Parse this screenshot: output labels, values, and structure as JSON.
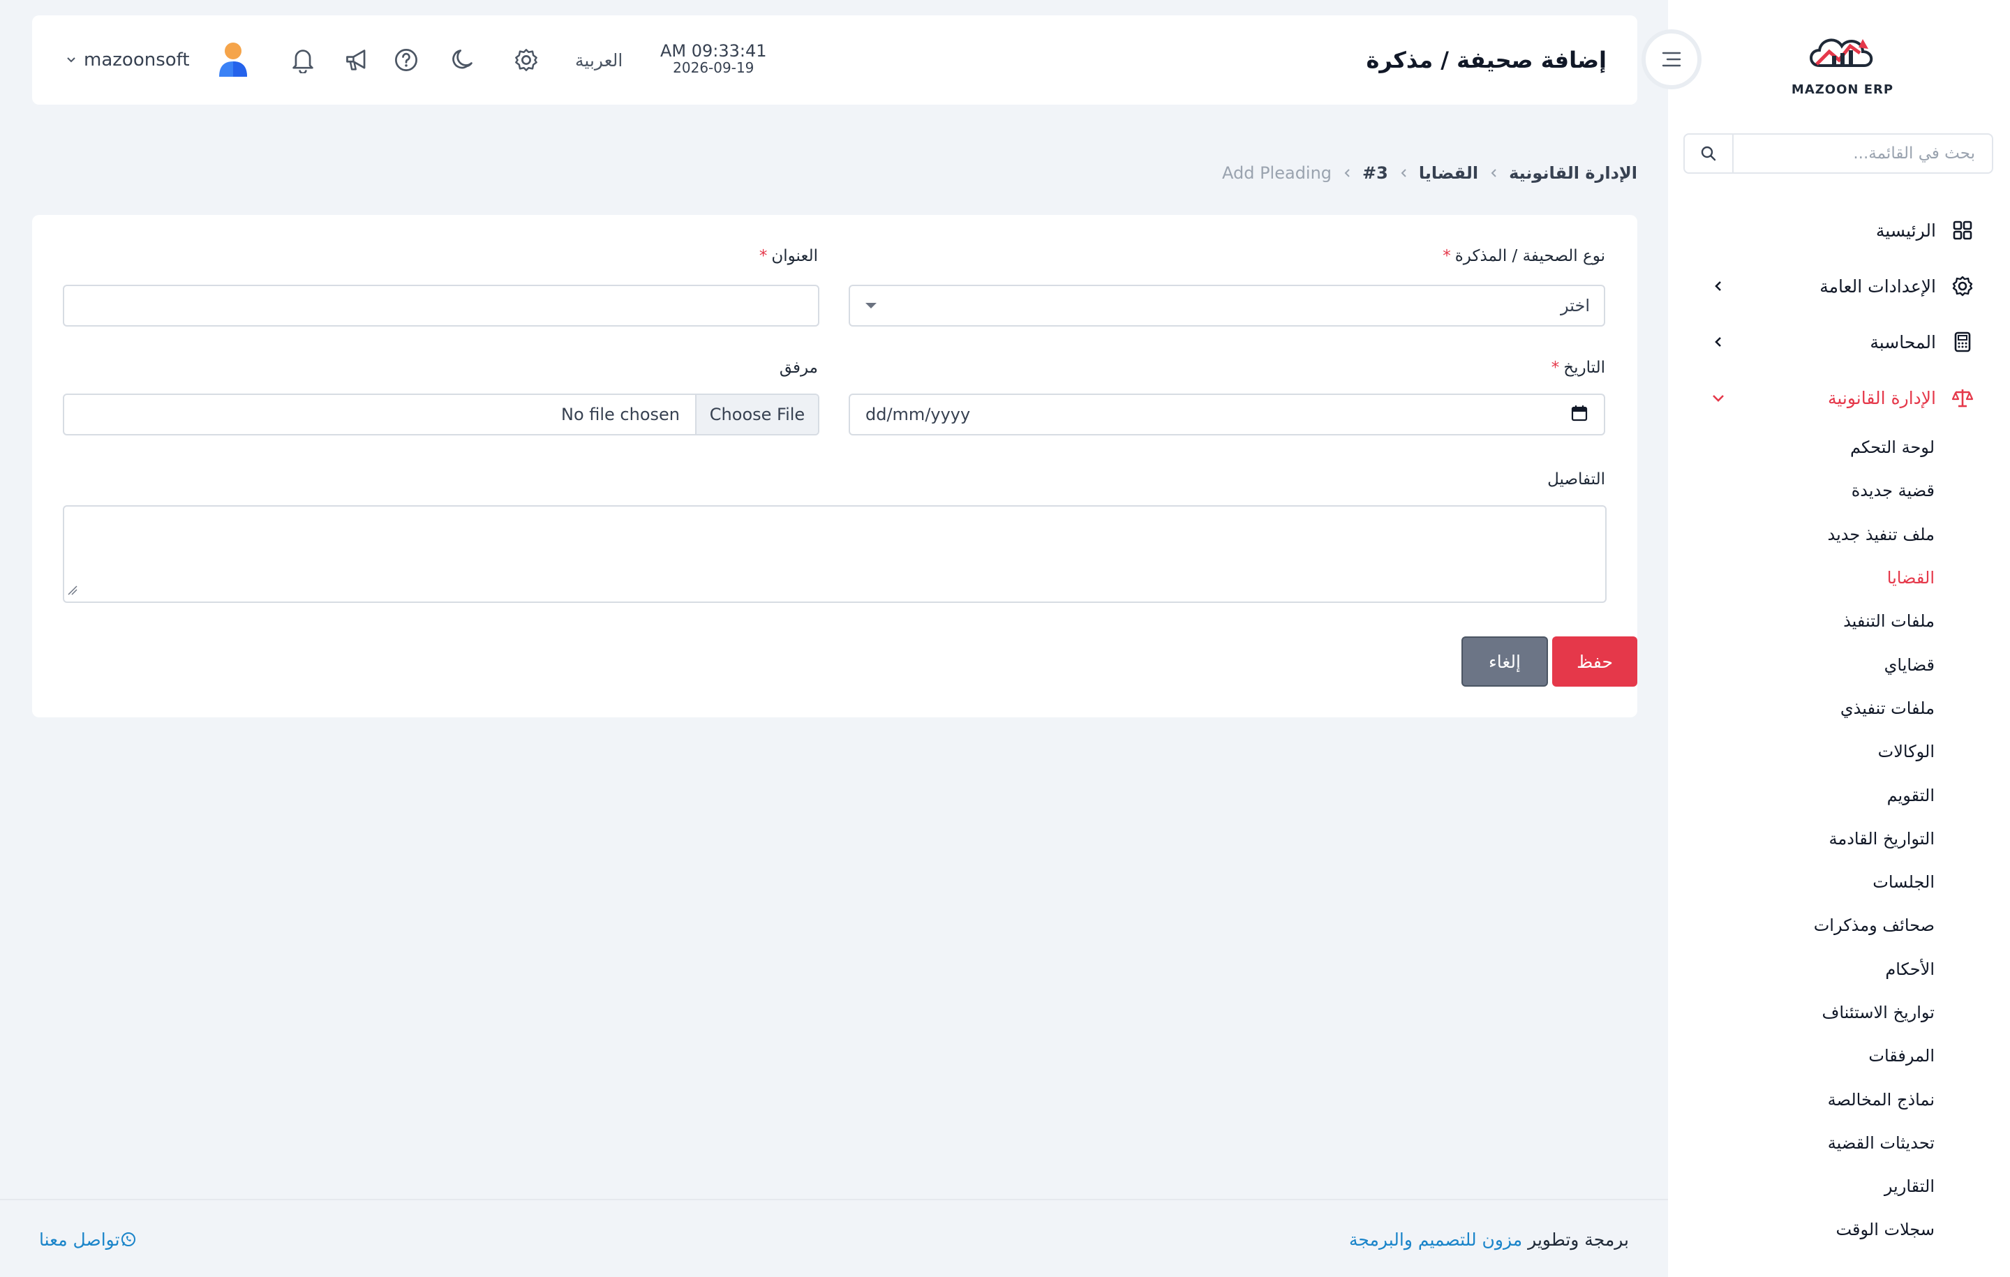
{
  "app": {
    "logo_text": "MAZOON ERP"
  },
  "sidebar": {
    "search_placeholder": "بحث في القائمة...",
    "items": [
      {
        "label": "الرئيسية",
        "icon": "grid-icon",
        "has_children": false
      },
      {
        "label": "الإعدادات العامة",
        "icon": "gear-icon",
        "has_children": true
      },
      {
        "label": "المحاسبة",
        "icon": "calculator-icon",
        "has_children": true
      },
      {
        "label": "الإدارة القانونية",
        "icon": "scale-icon",
        "has_children": true,
        "expanded": true
      }
    ],
    "legal_submenu": [
      "لوحة التحكم",
      "قضية جديدة",
      "ملف تنفيذ جديد",
      "القضايا",
      "ملفات التنفيذ",
      "قضاياي",
      "ملفات تنفيذي",
      "الوكالات",
      "التقويم",
      "التواريخ القادمة",
      "الجلسات",
      "صحائف ومذكرات",
      "الأحكام",
      "تواريخ الاستئناف",
      "المرفقات",
      "نماذج المخالصة",
      "تحديثات القضية",
      "التقارير",
      "سجلات الوقت"
    ],
    "active_submenu_index": 3,
    "active_color": "#e5384a"
  },
  "header": {
    "page_title": "إضافة صحيفة / مذكرة",
    "time": "AM 09:33:41",
    "date": "2026-09-19",
    "language": "العربية",
    "username": "mazoonsoft",
    "icons": [
      "gear-icon",
      "moon-icon",
      "help-icon",
      "megaphone-icon",
      "bell-icon",
      "avatar-icon"
    ]
  },
  "breadcrumb": [
    "الإدارة القانونية",
    "القضايا",
    "#3",
    "Add Pleading"
  ],
  "form": {
    "pleading_type_label": "نوع الصحيفة / المذكرة",
    "pleading_type_value": "اختر",
    "title_label": "العنوان",
    "title_value": "",
    "date_label": "التاريخ",
    "date_value": "dd/mm/yyyy",
    "attachment_label": "مرفق",
    "file_button": "Choose File",
    "file_status": "No file chosen",
    "details_label": "التفاصيل",
    "details_value": "",
    "required_mark": "*",
    "save_label": "حفظ",
    "cancel_label": "إلغاء"
  },
  "footer": {
    "credit_prefix": "برمجة وتطوير",
    "credit_brand": "مزون للتصميم والبرمجة",
    "contact_label": "تواصل معنا"
  },
  "colors": {
    "accent": "#e5384a",
    "link": "#1a84c9",
    "page_bg": "#f1f4f8",
    "cancel": "#6c7586"
  }
}
